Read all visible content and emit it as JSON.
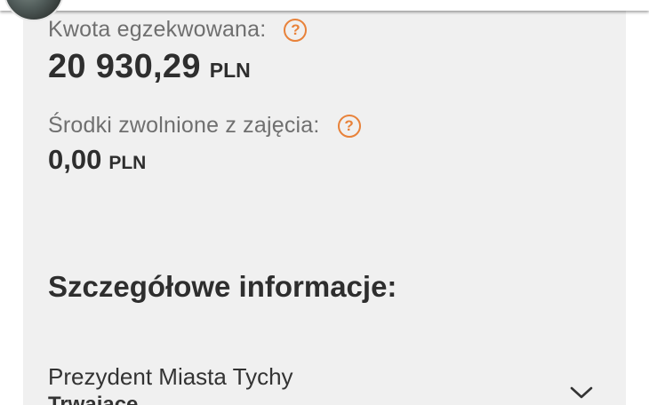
{
  "enforced": {
    "label": "Kwota egzekwowana:",
    "amount": "20 930,29",
    "currency": "PLN"
  },
  "released": {
    "label": "Środki zwolnione z zajęcia:",
    "amount": "0,00",
    "currency": "PLN"
  },
  "help_icon_glyph": "?",
  "details": {
    "title": "Szczegółowe informacje:",
    "item": {
      "name": "Prezydent Miasta Tychy",
      "status": "Trwające"
    }
  },
  "icons": {
    "help": "help-circle-icon",
    "expand": "chevron-down-icon"
  },
  "colors": {
    "accent": "#e8823a",
    "card_background": "#f0f0f0"
  }
}
